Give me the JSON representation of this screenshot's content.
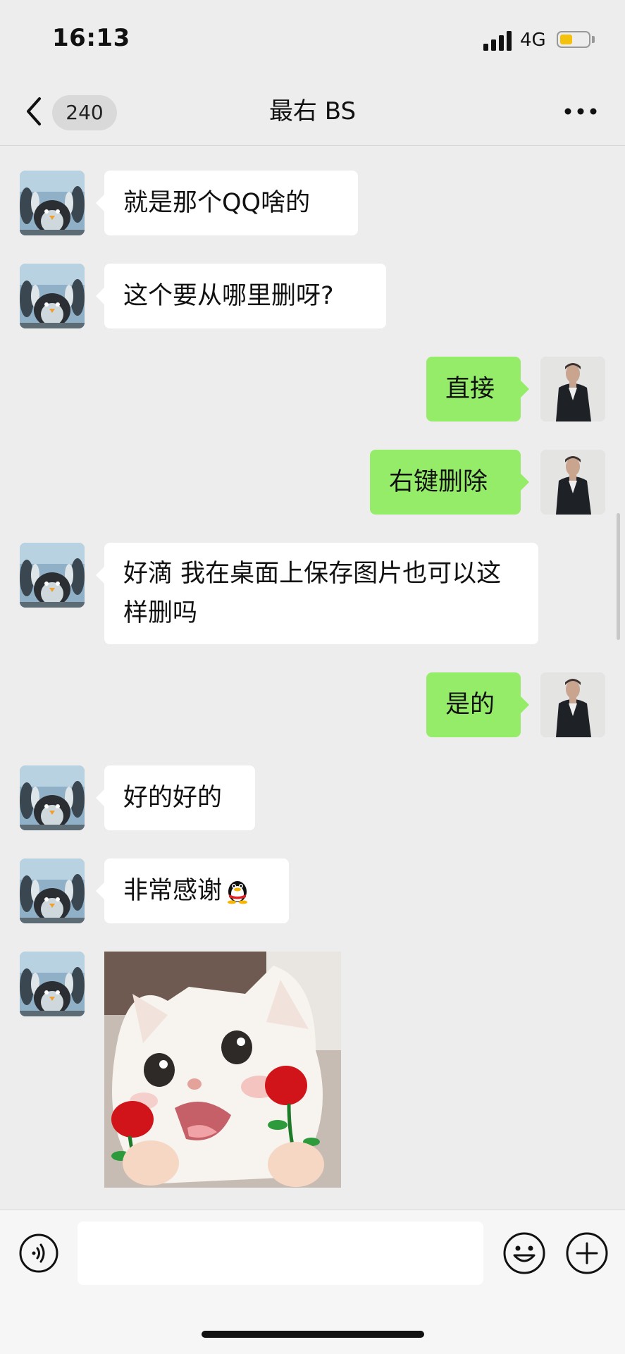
{
  "status_bar": {
    "time": "16:13",
    "network": "4G",
    "battery_level": 0.45
  },
  "header": {
    "unread_count": "240",
    "title": "最右 BS"
  },
  "messages": [
    {
      "side": "in",
      "text": "就是那个QQ啥的"
    },
    {
      "side": "in",
      "text": "这个要从哪里删呀?"
    },
    {
      "side": "out",
      "text": "直接"
    },
    {
      "side": "out",
      "text": "右键删除"
    },
    {
      "side": "in",
      "text": "好滴 我在桌面上保存图片也可以这样删吗"
    },
    {
      "side": "out",
      "text": "是的"
    },
    {
      "side": "in",
      "text": "好的好的"
    },
    {
      "side": "in",
      "text": "非常感谢",
      "emoji": "qq-penguin-icon"
    },
    {
      "side": "in",
      "type": "sticker",
      "sticker": "kitten-with-roses-sticker"
    }
  ],
  "input": {
    "value": "",
    "placeholder": ""
  },
  "colors": {
    "background": "#ededed",
    "outgoing_bubble": "#95ec69",
    "incoming_bubble": "#ffffff",
    "battery": "#f4c20d"
  },
  "icons": {
    "back": "chevron-left-icon",
    "more": "more-dots-icon",
    "voice": "voice-icon",
    "emoji": "emoji-icon",
    "plus": "plus-icon"
  }
}
